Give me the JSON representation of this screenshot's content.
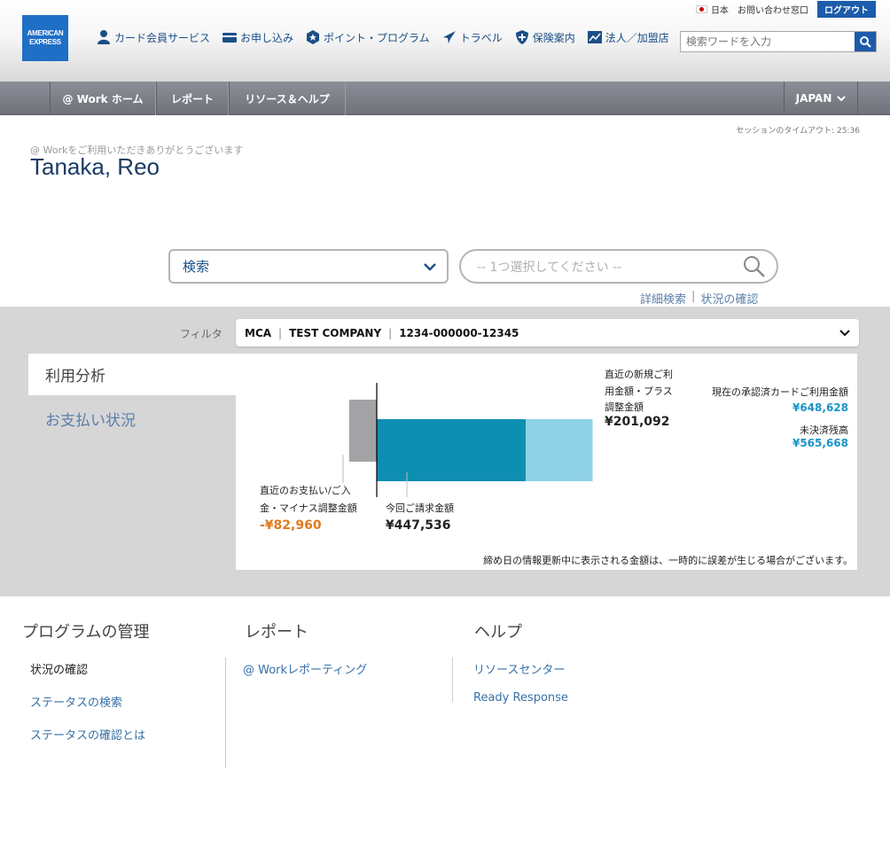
{
  "header": {
    "logo": {
      "line1": "AMERICAN",
      "line2": "EXPRESS"
    },
    "topnav": [
      {
        "label": "カード会員サービス",
        "icon": "person-icon"
      },
      {
        "label": "お申し込み",
        "icon": "card-icon"
      },
      {
        "label": "ポイント・プログラム",
        "icon": "star-badge-icon"
      },
      {
        "label": "トラベル",
        "icon": "airplane-icon"
      },
      {
        "label": "保険案内",
        "icon": "shield-icon"
      },
      {
        "label": "法人／加盟店",
        "icon": "chart-icon"
      }
    ],
    "utility": {
      "country": "日本",
      "contact": "お問い合わせ窓口",
      "logout": "ログアウト"
    },
    "search_placeholder": "検索ワードを入力"
  },
  "navbar": {
    "tabs": [
      "@ Work ホーム",
      "レポート",
      "リソース＆ヘルプ"
    ],
    "region": "JAPAN"
  },
  "session": {
    "timeout": "セッションのタイムアウト: 25:36"
  },
  "welcome": {
    "text": "@ Workをご利用いただきありがとうございます",
    "name": "Tanaka, Reo"
  },
  "search": {
    "category": "検索",
    "placeholder": "-- 1つ選択してください --",
    "advanced": "詳細検索",
    "separator": "|",
    "status": "状況の確認"
  },
  "filter": {
    "label": "フィルタ",
    "program": "MCA",
    "company": "TEST COMPANY",
    "account": "1234-000000-12345"
  },
  "side": {
    "active": "利用分析",
    "other": "お支払い状況"
  },
  "chart": {
    "payment_label_1": "直近のお支払い/ご入",
    "payment_label_2": "金・マイナス調整金額",
    "payment_amount": "-¥82,960",
    "bill_label": "今回ご請求金額",
    "bill_amount": "¥447,536",
    "new_label_1": "直近の新規ご利",
    "new_label_2": "用金額・プラス",
    "new_label_3": "調整金額",
    "new_amount": "¥201,092",
    "approved_label": "現在の承認済カードご利用金額",
    "approved_amount": "¥648,628",
    "unsettled_label": "未決済残高",
    "unsettled_amount": "¥565,668",
    "note": "締め日の情報更新中に表示される金額は、一時的に誤差が生じる場合がございます。",
    "colors": {
      "payment": "#a3a3a6",
      "bill": "#0e8fb2",
      "new": "#8fd2e6"
    }
  },
  "chart_data": {
    "type": "bar",
    "orientation": "horizontal",
    "categories": [
      "直近のお支払い/ご入金・マイナス調整金額",
      "今回ご請求金額",
      "直近の新規ご利用金額・プラス調整金額"
    ],
    "values": [
      -82960,
      447536,
      201092
    ]
  },
  "footer": {
    "col1": {
      "title": "プログラムの管理",
      "links": [
        "状況の確認",
        "ステータスの検索",
        "ステータスの確認とは"
      ]
    },
    "col2": {
      "title": "レポート",
      "links": [
        "@ Workレポーティング"
      ]
    },
    "col3": {
      "title": "ヘルプ",
      "links": [
        "リソースセンター",
        "Ready Response"
      ]
    }
  }
}
